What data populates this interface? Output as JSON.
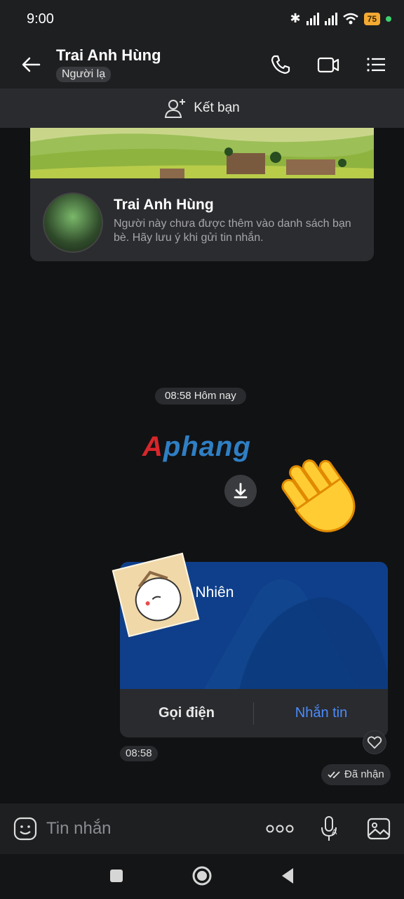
{
  "status_bar": {
    "time": "9:00",
    "battery": "75"
  },
  "header": {
    "contact_name": "Trai Anh Hùng",
    "badge": "Người lạ"
  },
  "add_friend": {
    "label": "Kết bạn"
  },
  "profile_card": {
    "name": "Trai Anh Hùng",
    "warning": "Người này chưa được thêm vào danh sách bạn bè. Hãy lưu ý khi gửi tin nhắn."
  },
  "chat": {
    "time_divider": "08:58 Hôm nay",
    "watermark_a": "A",
    "watermark_rest": "phang",
    "contact_card": {
      "name": "n Nhiên",
      "call_label": "Gọi điện",
      "message_label": "Nhắn tin"
    },
    "message_time": "08:58",
    "status": "Đã nhận"
  },
  "composer": {
    "placeholder": "Tin nhắn"
  },
  "icons": [
    "back-arrow-icon",
    "phone-icon",
    "video-call-icon",
    "menu-list-icon",
    "add-user-icon",
    "download-icon",
    "wave-emoji-icon",
    "heart-icon",
    "double-check-icon",
    "emoji-icon",
    "more-dots-icon",
    "mic-icon",
    "image-icon",
    "recent-apps-icon",
    "home-icon",
    "back-nav-icon"
  ]
}
